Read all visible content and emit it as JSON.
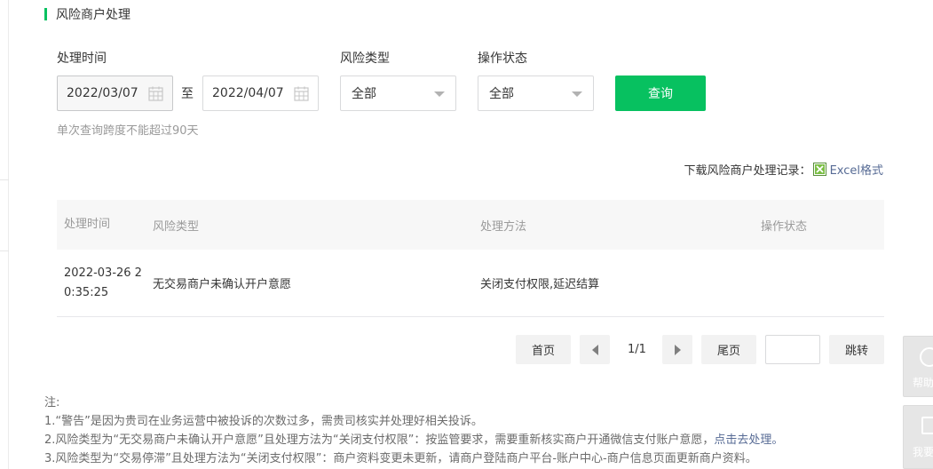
{
  "section_title": "风险商户处理",
  "filters": {
    "time_label": "处理时间",
    "start_date": "2022/03/07",
    "to_label": "至",
    "end_date": "2022/04/07",
    "risk_type_label": "风险类型",
    "risk_type_value": "全部",
    "status_label": "操作状态",
    "status_value": "全部",
    "query_button": "查询",
    "hint": "单次查询跨度不能超过90天"
  },
  "download": {
    "label": "下载风险商户处理记录：",
    "link": "Excel格式"
  },
  "table": {
    "headers": [
      "处理时间",
      "风险类型",
      "处理方法",
      "操作状态"
    ],
    "rows": [
      {
        "time_line1": "2022-03-26 2",
        "time_line2": "0:35:25",
        "risk_type": "无交易商户未确认开户意愿",
        "method": "关闭支付权限,延迟结算",
        "status": ""
      }
    ]
  },
  "pagination": {
    "first": "首页",
    "info": "1/1",
    "last": "尾页",
    "jump": "跳转"
  },
  "notes": {
    "title": "注:",
    "line1": "1.“警告”是因为贵司在业务运营中被投诉的次数过多，需贵司核实并处理好相关投诉。",
    "line2_prefix": "2.风险类型为“无交易商户未确认开户意愿”且处理方法为“关闭支付权限”：按监管要求，需要重新核实商户开通微信支付账户意愿，",
    "line2_link": "点击去处理。",
    "line3": "3.风险类型为“交易停滞”且处理方法为“关闭支付权限”：商户资料变更未更新，请商户登陆商户平台-账户中心-商户信息页面更新商户资料。"
  },
  "side": {
    "help": "帮助",
    "feedback": "我要"
  },
  "colors": {
    "accent": "#07c160",
    "link": "#576b95"
  }
}
